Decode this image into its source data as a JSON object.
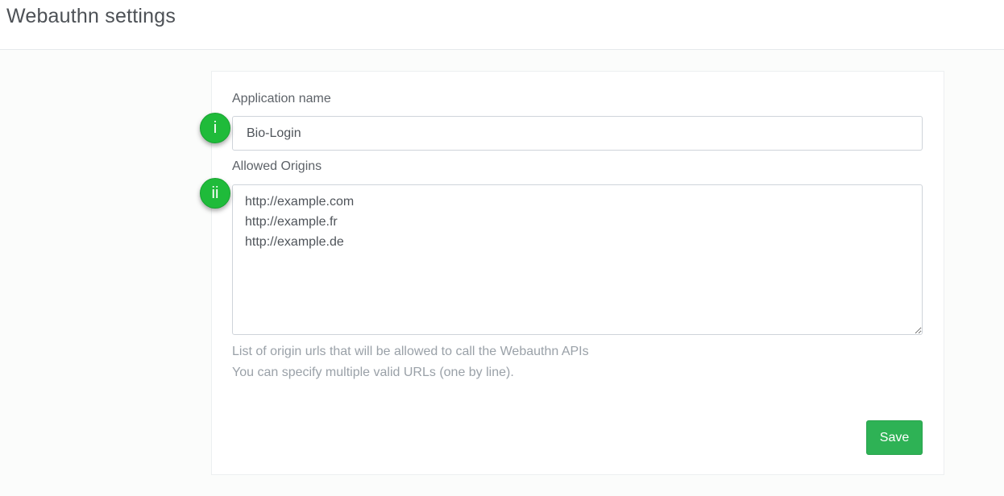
{
  "header": {
    "title": "Webauthn settings"
  },
  "form": {
    "app_name": {
      "label": "Application name",
      "value": "Bio-Login"
    },
    "allowed_origins": {
      "label": "Allowed Origins",
      "value": "http://example.com\nhttp://example.fr\nhttp://example.de",
      "help_lines": [
        "List of origin urls that will be allowed to call the Webauthn APIs",
        "You can specify multiple valid URLs (one by line)."
      ]
    },
    "save_label": "Save"
  },
  "markers": [
    {
      "label": "i"
    },
    {
      "label": "ii"
    }
  ],
  "colors": {
    "save_button": "#2eb255",
    "marker": "#1fbb3a"
  }
}
